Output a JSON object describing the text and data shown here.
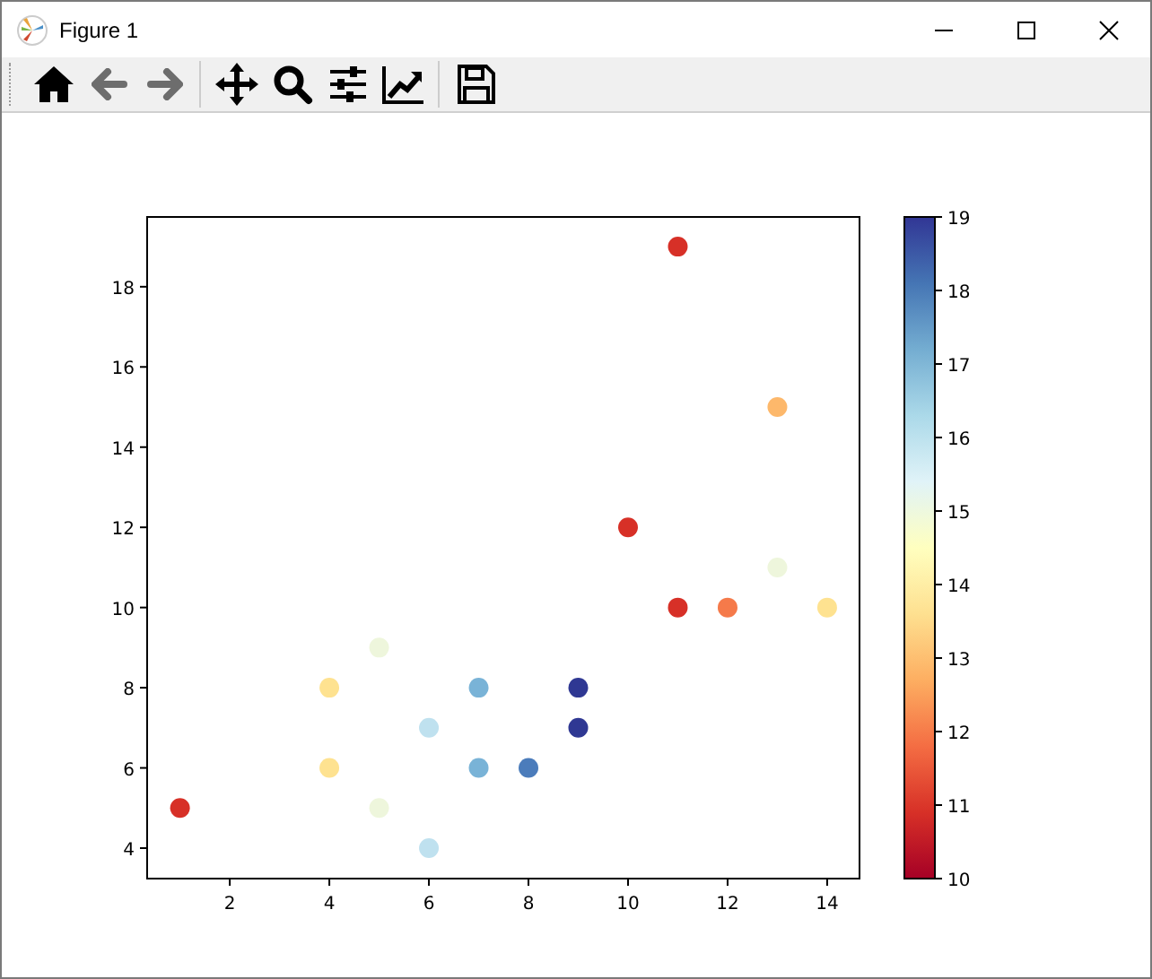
{
  "window": {
    "title": "Figure 1"
  },
  "toolbar": {
    "buttons": [
      {
        "kind": "home",
        "disabled": false
      },
      {
        "kind": "back",
        "disabled": true
      },
      {
        "kind": "forward",
        "disabled": true
      },
      {
        "kind": "separator"
      },
      {
        "kind": "pan",
        "disabled": false
      },
      {
        "kind": "zoom",
        "disabled": false
      },
      {
        "kind": "subplots",
        "disabled": false
      },
      {
        "kind": "customize",
        "disabled": false
      },
      {
        "kind": "separator"
      },
      {
        "kind": "save",
        "disabled": false
      }
    ]
  },
  "figure": {
    "chart_data": {
      "type": "scatter",
      "xlim": [
        0.34,
        14.65
      ],
      "ylim": [
        3.24,
        19.74
      ],
      "xticks": [
        2,
        4,
        6,
        8,
        10,
        12,
        14
      ],
      "yticks": [
        4,
        6,
        8,
        10,
        12,
        14,
        16,
        18
      ],
      "series": [
        {
          "color": "#d73027",
          "x": [
            1,
            10,
            11,
            11
          ],
          "values": [
            5,
            12,
            19,
            10
          ]
        },
        {
          "color": "#fee290",
          "x": [
            4,
            4,
            14
          ],
          "values": [
            8,
            6,
            10
          ]
        },
        {
          "color": "#eef6dc",
          "x": [
            5,
            5,
            13
          ],
          "values": [
            9,
            5,
            11
          ]
        },
        {
          "color": "#bfe1ef",
          "x": [
            6,
            6
          ],
          "values": [
            7,
            4
          ]
        },
        {
          "color": "#79b3d7",
          "x": [
            7,
            7
          ],
          "values": [
            8,
            6
          ]
        },
        {
          "color": "#4b7cbb",
          "x": [
            8
          ],
          "values": [
            6
          ]
        },
        {
          "color": "#2f3893",
          "x": [
            9,
            9
          ],
          "values": [
            8,
            7
          ]
        },
        {
          "color": "#f57a4a",
          "x": [
            12
          ],
          "values": [
            10
          ]
        },
        {
          "color": "#fdb86b",
          "x": [
            13
          ],
          "values": [
            15
          ]
        }
      ]
    },
    "colorbar": {
      "ticks": [
        "19",
        "18",
        "17",
        "16",
        "15",
        "14",
        "13",
        "12",
        "11",
        "10"
      ]
    }
  }
}
